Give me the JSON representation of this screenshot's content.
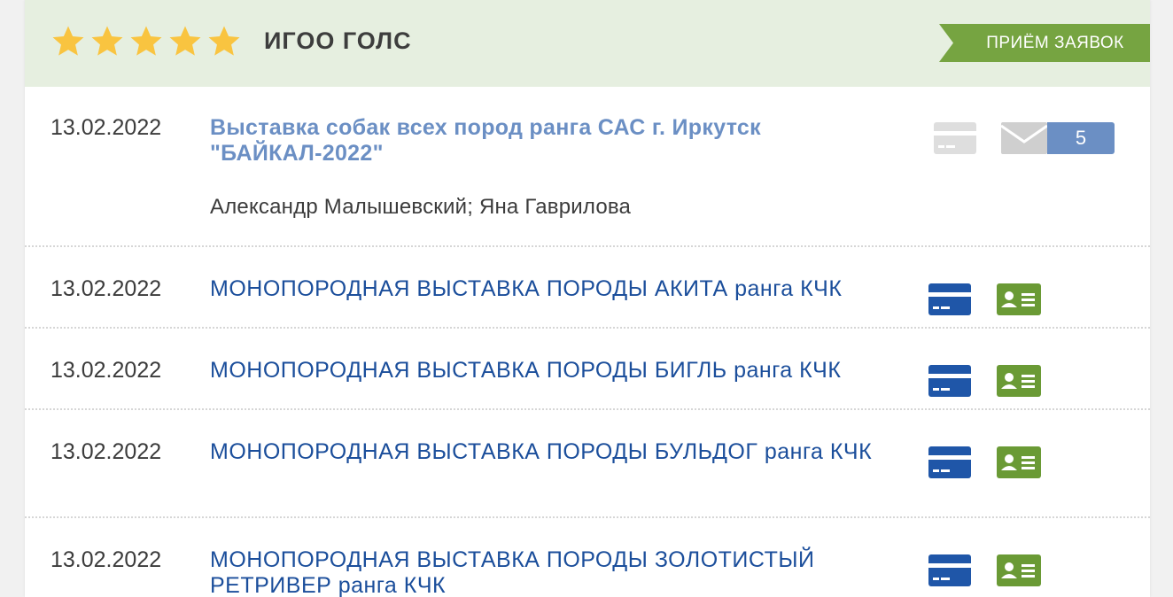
{
  "organization": {
    "name": "ИГОО ГОЛС",
    "rating": 5,
    "status_label": "ПРИЁМ ЗАЯВОК"
  },
  "events": [
    {
      "date": "13.02.2022",
      "title": "Выставка собак всех пород ранга САС г. Иркутск \"БАЙКАЛ-2022\"",
      "judges": "Александр Малышевский; Яна Гаврилова",
      "messages_count": "5"
    },
    {
      "date": "13.02.2022",
      "title": "МОНОПОРОДНАЯ ВЫСТАВКА ПОРОДЫ АКИТА ранга КЧК"
    },
    {
      "date": "13.02.2022",
      "title": "МОНОПОРОДНАЯ ВЫСТАВКА ПОРОДЫ БИГЛЬ ранга КЧК"
    },
    {
      "date": "13.02.2022",
      "title": "МОНОПОРОДНАЯ ВЫСТАВКА ПОРОДЫ БУЛЬДОГ ранга КЧК"
    },
    {
      "date": "13.02.2022",
      "title": "МОНОПОРОДНАЯ ВЫСТАВКА ПОРОДЫ ЗОЛОТИСТЫЙ РЕТРИВЕР ранга КЧК"
    }
  ],
  "icons": {
    "star": "star-icon",
    "payment": "credit-card-icon",
    "registration": "id-card-icon",
    "messages": "envelope-icon"
  },
  "colors": {
    "header_bg": "#e6efe0",
    "star": "#f9c440",
    "ribbon": "#76a441",
    "link": "#1b4e9b",
    "link_muted": "#6b8fc4",
    "card_icon": "#1f56a8",
    "id_icon": "#6a9a35"
  }
}
